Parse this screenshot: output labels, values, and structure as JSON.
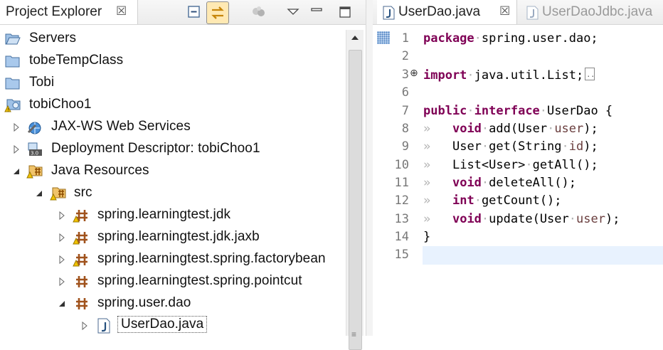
{
  "explorer": {
    "tab_label": "Project Explorer",
    "close_glyph": "☒",
    "toolbar": [
      "collapse-all-icon",
      "link-with-editor-icon",
      "focus-icon",
      "view-menu-icon",
      "minimize-icon",
      "maximize-icon"
    ]
  },
  "tree": [
    {
      "label": "Servers",
      "icon": "folder-open-icon",
      "expander": "none"
    },
    {
      "label": "tobeTempClass",
      "icon": "folder-icon",
      "expander": "none"
    },
    {
      "label": "Tobi",
      "icon": "folder-icon",
      "expander": "none"
    },
    {
      "label": "tobiChoo1",
      "icon": "web-project-icon",
      "expander": "none"
    },
    {
      "label": "JAX-WS Web Services",
      "icon": "web-services-icon",
      "expander": "collapsed"
    },
    {
      "label": "Deployment Descriptor: tobiChoo1",
      "icon": "deployment-descriptor-icon",
      "expander": "collapsed"
    },
    {
      "label": "Java Resources",
      "icon": "java-resources-icon",
      "expander": "expanded"
    },
    {
      "label": "src",
      "icon": "source-folder-icon",
      "expander": "expanded"
    },
    {
      "label": "spring.learningtest.jdk",
      "icon": "package-warning-icon",
      "expander": "collapsed"
    },
    {
      "label": "spring.learningtest.jdk.jaxb",
      "icon": "package-warning-icon",
      "expander": "collapsed"
    },
    {
      "label": "spring.learningtest.spring.factorybean",
      "icon": "package-warning-icon",
      "expander": "collapsed"
    },
    {
      "label": "spring.learningtest.spring.pointcut",
      "icon": "package-icon",
      "expander": "collapsed"
    },
    {
      "label": "spring.user.dao",
      "icon": "package-icon",
      "expander": "expanded"
    },
    {
      "label": "UserDao.java",
      "icon": "java-file-icon",
      "expander": "collapsed"
    }
  ],
  "editor": {
    "tabs": [
      {
        "label": "UserDao.java",
        "active": true
      },
      {
        "label": "UserDaoJdbc.java",
        "active": false
      }
    ],
    "close_glyph": "☒",
    "line_numbers": [
      "1",
      "2",
      "3",
      "6",
      "7",
      "8",
      "9",
      "10",
      "11",
      "12",
      "13",
      "14",
      "15"
    ],
    "code": {
      "l1_kw": "package",
      "l1_rest": "spring.user.dao;",
      "l3_kw": "import",
      "l3_rest": "java.util.List;",
      "l7_kw1": "public",
      "l7_kw2": "interface",
      "l7_rest": "UserDao {",
      "l8_kw": "void",
      "l8_a": "add(User",
      "l8_p": "user",
      "l8_b": ");",
      "l9_a": "User",
      "l9_b": "get(String",
      "l9_p": "id",
      "l9_c": ");",
      "l10": "List<User>",
      "l10_b": "getAll();",
      "l11_kw": "void",
      "l11_b": "deleteAll();",
      "l12_kw": "int",
      "l12_b": "getCount();",
      "l13_kw": "void",
      "l13_a": "update(User",
      "l13_p": "user",
      "l13_b": ");",
      "l14": "}",
      "tab_glyph": "»",
      "space_glyph": "·"
    }
  }
}
